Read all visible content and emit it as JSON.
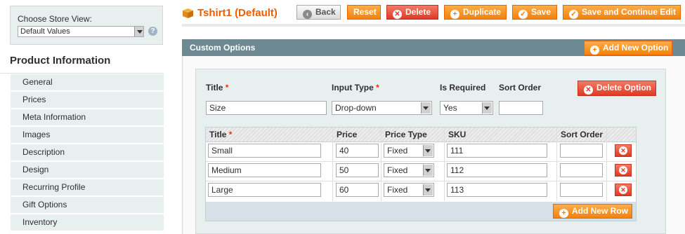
{
  "sidebar": {
    "store_view_label": "Choose Store View:",
    "store_view_value": "Default Values",
    "section_title": "Product Information",
    "items": [
      {
        "label": "General"
      },
      {
        "label": "Prices"
      },
      {
        "label": "Meta Information"
      },
      {
        "label": "Images"
      },
      {
        "label": "Description"
      },
      {
        "label": "Design"
      },
      {
        "label": "Recurring Profile"
      },
      {
        "label": "Gift Options"
      },
      {
        "label": "Inventory"
      }
    ]
  },
  "header": {
    "product_title": "Tshirt1 (Default)",
    "buttons": {
      "back": "Back",
      "reset": "Reset",
      "delete": "Delete",
      "duplicate": "Duplicate",
      "save": "Save",
      "save_continue": "Save and Continue Edit"
    }
  },
  "custom_options": {
    "title": "Custom Options",
    "add_new_option": "Add New Option",
    "option": {
      "labels": {
        "title": "Title",
        "required_mark": "*",
        "input_type": "Input Type",
        "is_required": "Is Required",
        "sort_order": "Sort Order"
      },
      "title_value": "Size",
      "input_type_value": "Drop-down",
      "is_required_value": "Yes",
      "sort_order_value": "",
      "delete_option": "Delete Option",
      "table": {
        "columns": [
          "Title",
          "Price",
          "Price Type",
          "SKU",
          "Sort Order"
        ],
        "rows": [
          {
            "title": "Small",
            "price": "40",
            "price_type": "Fixed",
            "sku": "111",
            "sort_order": ""
          },
          {
            "title": "Medium",
            "price": "50",
            "price_type": "Fixed",
            "sku": "112",
            "sort_order": ""
          },
          {
            "title": "Large",
            "price": "60",
            "price_type": "Fixed",
            "sku": "113",
            "sort_order": ""
          }
        ],
        "add_new_row": "Add New Row"
      }
    }
  },
  "colors": {
    "brand_orange": "#eb5e00",
    "button_orange": "#f1820f",
    "delete_red": "#df3a24",
    "section_header": "#6f8992",
    "panel_bg": "#e7efef"
  },
  "icons": {
    "product": "box-icon",
    "back": "arrow-left-icon",
    "delete": "x-circle-icon",
    "add": "plus-circle-icon",
    "save": "check-circle-icon",
    "help": "question-icon"
  }
}
